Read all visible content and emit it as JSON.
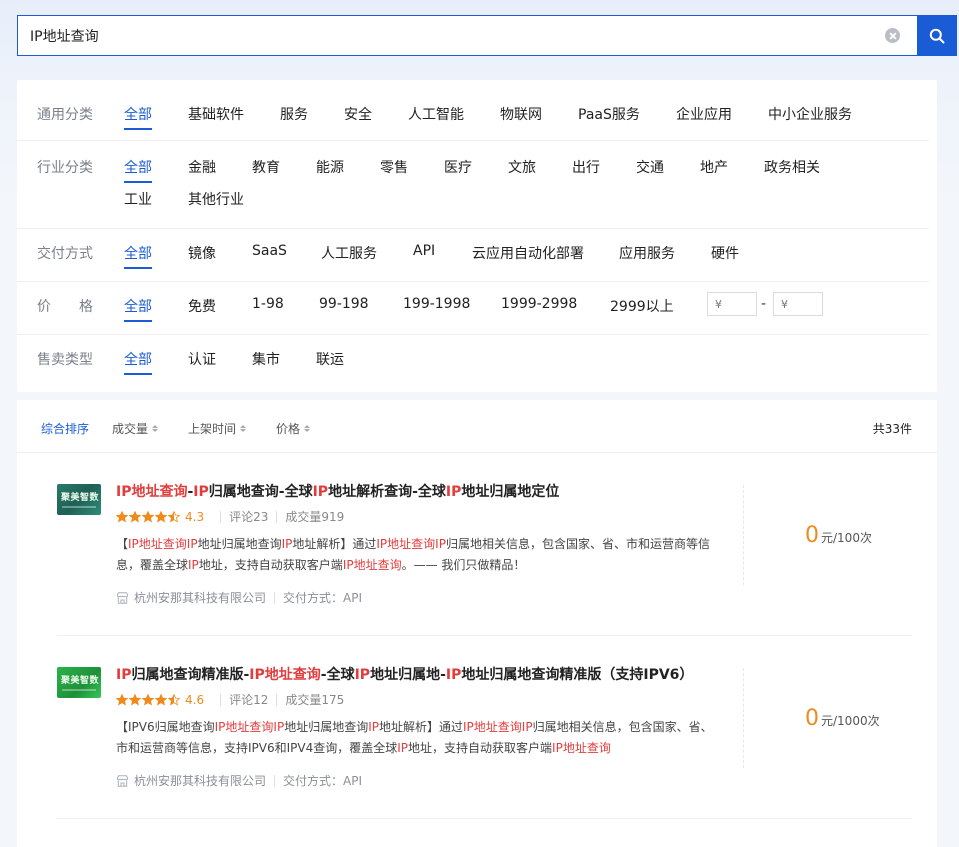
{
  "search": {
    "value": "IP地址查询",
    "placeholder": ""
  },
  "filters": [
    {
      "label": "通用分类",
      "options": [
        "全部",
        "基础软件",
        "服务",
        "安全",
        "人工智能",
        "物联网",
        "PaaS服务",
        "企业应用",
        "中小企业服务"
      ],
      "active": "全部"
    },
    {
      "label": "行业分类",
      "options": [
        "全部",
        "金融",
        "教育",
        "能源",
        "零售",
        "医疗",
        "文旅",
        "出行",
        "交通",
        "地产",
        "政务相关",
        "工业",
        "其他行业"
      ],
      "active": "全部"
    },
    {
      "label": "交付方式",
      "options": [
        "全部",
        "镜像",
        "SaaS",
        "人工服务",
        "API",
        "云应用自动化部署",
        "应用服务",
        "硬件"
      ],
      "active": "全部"
    },
    {
      "label": "价　　格",
      "options": [
        "全部",
        "免费",
        "1-98",
        "99-198",
        "199-1998",
        "1999-2998",
        "2999以上"
      ],
      "active": "全部",
      "range": {
        "min_placeholder": "¥",
        "max_placeholder": "¥",
        "dash": "-"
      }
    },
    {
      "label": "售卖类型",
      "options": [
        "全部",
        "认证",
        "集市",
        "联运"
      ],
      "active": "全部"
    }
  ],
  "sort": {
    "items": [
      "综合排序",
      "成交量",
      "上架时间",
      "价格"
    ],
    "active": "综合排序",
    "total": "共33件"
  },
  "products": [
    {
      "thumb_text": "聚美智数",
      "title_parts": [
        {
          "t": "IP地址查询",
          "hl": true
        },
        {
          "t": "-",
          "hl": false
        },
        {
          "t": "IP",
          "hl": true
        },
        {
          "t": "归属地查询-全球",
          "hl": false
        },
        {
          "t": "IP",
          "hl": true
        },
        {
          "t": "地址解析查询-全球",
          "hl": false
        },
        {
          "t": "IP",
          "hl": true
        },
        {
          "t": "地址归属地定位",
          "hl": false
        }
      ],
      "rating": "4.3",
      "stars": 4.5,
      "reviews": "评论23",
      "deals": "成交量919",
      "desc_parts": [
        {
          "t": "【",
          "hl": false
        },
        {
          "t": "IP地址查询",
          "hl": true
        },
        {
          "t": "IP",
          "hl": true
        },
        {
          "t": "地址归属地查询",
          "hl": false
        },
        {
          "t": "IP",
          "hl": true
        },
        {
          "t": "地址解析】通过",
          "hl": false
        },
        {
          "t": "IP地址查询",
          "hl": true
        },
        {
          "t": "IP",
          "hl": true
        },
        {
          "t": "归属地相关信息，包含国家、省、市和运营商等信息，覆盖全球",
          "hl": false
        },
        {
          "t": "IP",
          "hl": true
        },
        {
          "t": "地址，支持自动获取客户端",
          "hl": false
        },
        {
          "t": "IP地址查询",
          "hl": true
        },
        {
          "t": "。—— 我们只做精品！",
          "hl": false
        }
      ],
      "vendor": "杭州安那其科技有限公司",
      "delivery": "交付方式：API",
      "price": "0",
      "unit": "元/100次"
    },
    {
      "thumb_text": "聚美智数",
      "title_parts": [
        {
          "t": "IP",
          "hl": true
        },
        {
          "t": "归属地查询精准版-",
          "hl": false
        },
        {
          "t": "IP地址查询",
          "hl": true
        },
        {
          "t": "-全球",
          "hl": false
        },
        {
          "t": "IP",
          "hl": true
        },
        {
          "t": "地址归属地-",
          "hl": false
        },
        {
          "t": "IP",
          "hl": true
        },
        {
          "t": "地址归属地查询精准版（支持IPV6）",
          "hl": false
        }
      ],
      "rating": "4.6",
      "stars": 4.5,
      "reviews": "评论12",
      "deals": "成交量175",
      "desc_parts": [
        {
          "t": "【IPV6归属地查询",
          "hl": false
        },
        {
          "t": "IP地址查询",
          "hl": true
        },
        {
          "t": "IP",
          "hl": true
        },
        {
          "t": "地址归属地查询",
          "hl": false
        },
        {
          "t": "IP",
          "hl": true
        },
        {
          "t": "地址解析】通过",
          "hl": false
        },
        {
          "t": "IP地址查询",
          "hl": true
        },
        {
          "t": "IP",
          "hl": true
        },
        {
          "t": "归属地相关信息，包含国家、省、市和运营商等信息，支持IPV6和IPV4查询，覆盖全球",
          "hl": false
        },
        {
          "t": "IP",
          "hl": true
        },
        {
          "t": "地址，支持自动获取客户端",
          "hl": false
        },
        {
          "t": "IP地址查询",
          "hl": true
        }
      ],
      "vendor": "杭州安那其科技有限公司",
      "delivery": "交付方式：API",
      "price": "0",
      "unit": "元/1000次"
    }
  ],
  "colors": {
    "accent": "#1a5cd6",
    "highlight": "#e23c3c",
    "rating": "#f08a1d",
    "price": "#f08a1d"
  }
}
